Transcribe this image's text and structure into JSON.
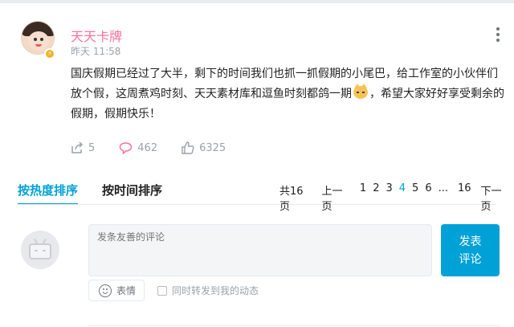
{
  "post": {
    "username": "天天卡牌",
    "time": "昨天 11:58",
    "content_part1": "国庆假期已经过了大半，剩下的时间我们也抓一抓假期的小尾巴，给工作室的小伙伴们放个假，这周煮鸡时刻、天天素材库和逗鱼时刻都鸽一期",
    "content_part2": "，希望大家好好享受剩余的假期，假期快乐！",
    "emoji_icon": "cat-face-emoji",
    "vip_badge": "⚡",
    "shares": "5",
    "comments": "462",
    "likes": "6325"
  },
  "sort_tabs": {
    "hot": "按热度排序",
    "time": "按时间排序"
  },
  "pagination": {
    "total": "共16页",
    "prev": "上一页",
    "pages": [
      "1",
      "2",
      "3",
      "4",
      "5",
      "6"
    ],
    "current": "4",
    "ellipsis": "...",
    "last": "16",
    "next": "下一页"
  },
  "comment_form": {
    "placeholder": "发条友善的评论",
    "submit": "发表\n评论",
    "emoji_label": "表情",
    "forward_label": "同时转发到我的动态"
  },
  "colors": {
    "accent": "#00a1d6",
    "username": "#fb7299"
  }
}
